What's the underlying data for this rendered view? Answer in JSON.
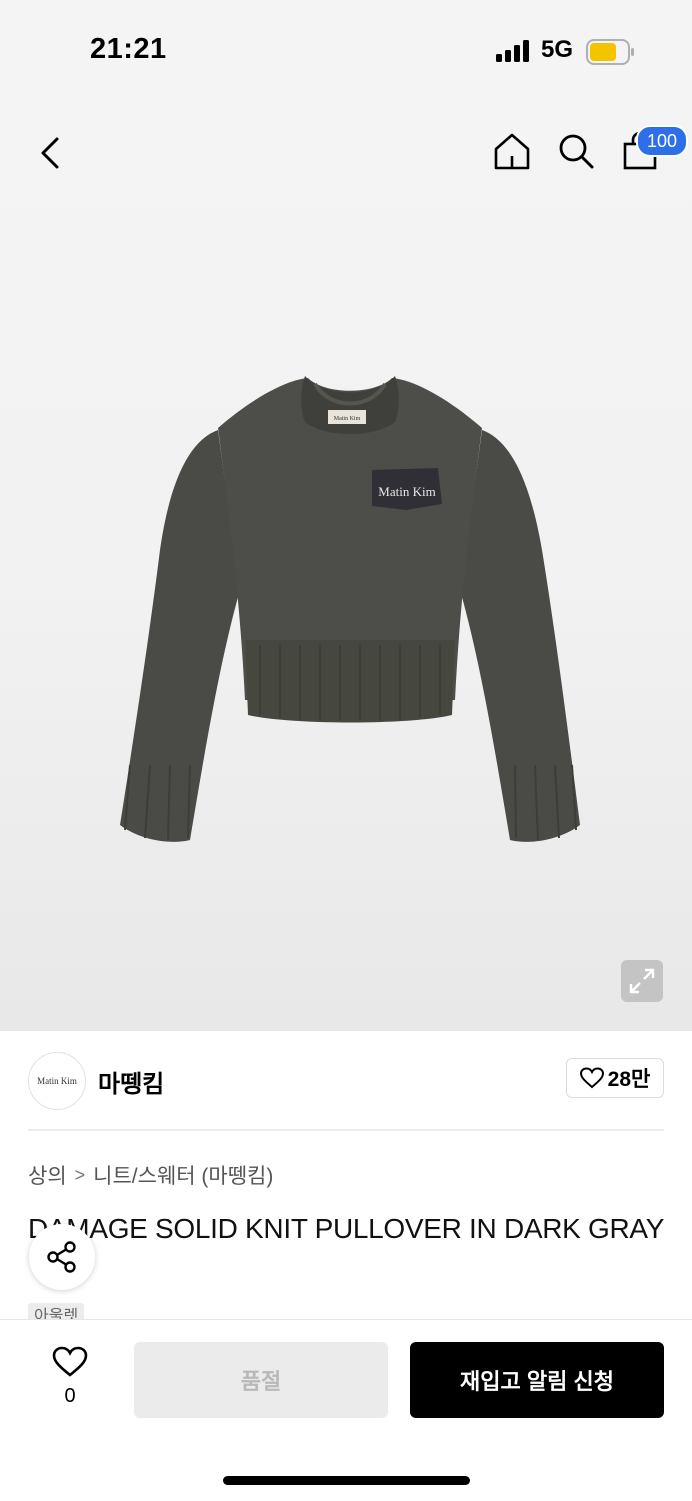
{
  "status": {
    "time": "21:21",
    "network": "5G",
    "battery_color": "#f5c400"
  },
  "nav": {
    "cart_count": "100",
    "badge_color": "#2c6fe8"
  },
  "brand": {
    "name": "마뗑킴",
    "logo_text": "Matin  Kim",
    "likes": "28만"
  },
  "breadcrumb": {
    "level1": "상의",
    "separator": ">",
    "level2": "니트/스웨터 (마뗑킴)"
  },
  "product": {
    "title": "DAMAGE SOLID KNIT PULLOVER IN DARK GRAY",
    "tag": "아울렛",
    "image_patch_text": "Matin  Kim",
    "neck_label_text": "Matin Kim"
  },
  "bottom": {
    "wish_count": "0",
    "soldout_label": "품절",
    "restock_label": "재입고 알림 신청"
  },
  "colors": {
    "sweater": "#4a4b46",
    "primary": "#000000",
    "disabled_bg": "#ebebeb"
  }
}
